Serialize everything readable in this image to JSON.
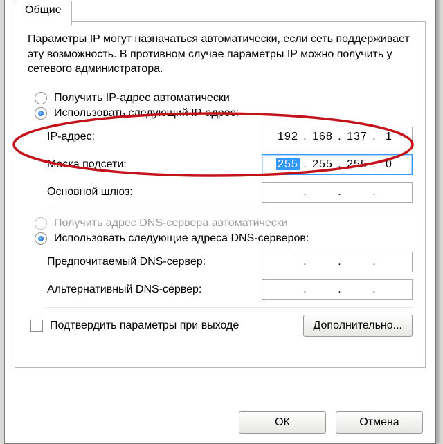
{
  "tab": {
    "label": "Общие"
  },
  "description": "Параметры IP могут назначаться автоматически, если сеть поддерживает эту возможность. В противном случае параметры IP можно получить у сетевого администратора.",
  "ip_section": {
    "auto_label": "Получить IP-адрес автоматически",
    "manual_label": "Использовать следующий IP-адрес:",
    "ip_label": "IP-адрес:",
    "ip_value": {
      "o1": "192",
      "o2": "168",
      "o3": "137",
      "o4": "1"
    },
    "mask_label": "Маска подсети:",
    "mask_value": {
      "o1": "255",
      "o2": "255",
      "o3": "255",
      "o4": "0"
    },
    "gateway_label": "Основной шлюз:"
  },
  "dns_section": {
    "auto_label": "Получить адрес DNS-сервера автоматически",
    "manual_label": "Использовать следующие адреса DNS-серверов:",
    "pref_label": "Предпочитаемый DNS-сервер:",
    "alt_label": "Альтернативный DNS-сервер:"
  },
  "confirm_label": "Подтвердить параметры при выходе",
  "advanced_label": "Дополнительно...",
  "buttons": {
    "ok": "ОК",
    "cancel": "Отмена"
  }
}
